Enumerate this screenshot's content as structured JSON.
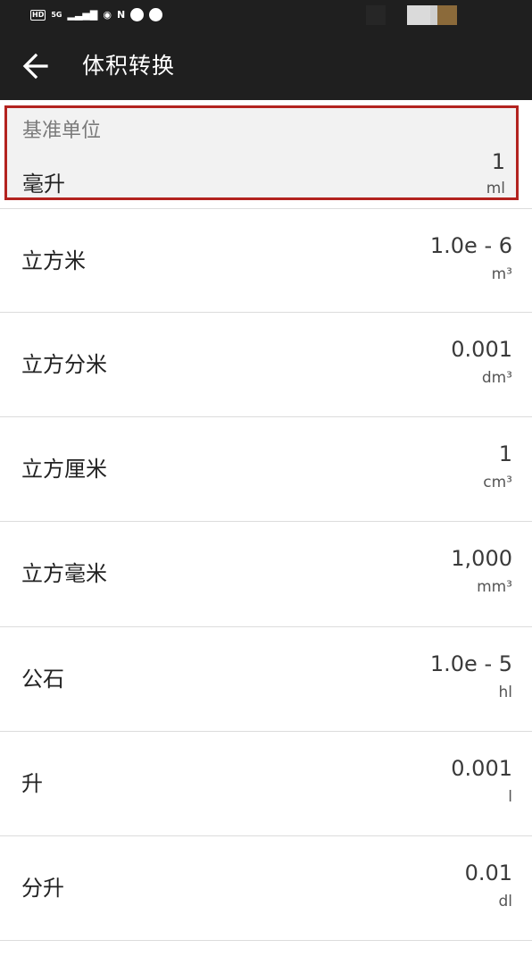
{
  "status_bar": {
    "network_label": "5G",
    "hd_label": "HD",
    "signal_glyph": "▂▃▅▇",
    "eye_glyph": "◉",
    "nfc_glyph": "N"
  },
  "header": {
    "title": "体积转换",
    "back_icon": "arrow-left-icon"
  },
  "base_unit": {
    "label": "基准单位",
    "name": "毫升",
    "value": "1",
    "symbol": "ml"
  },
  "units": [
    {
      "name": "立方米",
      "value": "1.0e - 6",
      "symbol": "m³"
    },
    {
      "name": "立方分米",
      "value": "0.001",
      "symbol": "dm³"
    },
    {
      "name": "立方厘米",
      "value": "1",
      "symbol": "cm³"
    },
    {
      "name": "立方毫米",
      "value": "1,000",
      "symbol": "mm³"
    },
    {
      "name": "公石",
      "value": "1.0e - 5",
      "symbol": "hl"
    },
    {
      "name": "升",
      "value": "0.001",
      "symbol": "l"
    },
    {
      "name": "分升",
      "value": "0.01",
      "symbol": "dl"
    }
  ],
  "colors": {
    "app_bar": "#1f1f1f",
    "highlight_border": "#b3231f",
    "base_background": "#f2f2f2"
  }
}
